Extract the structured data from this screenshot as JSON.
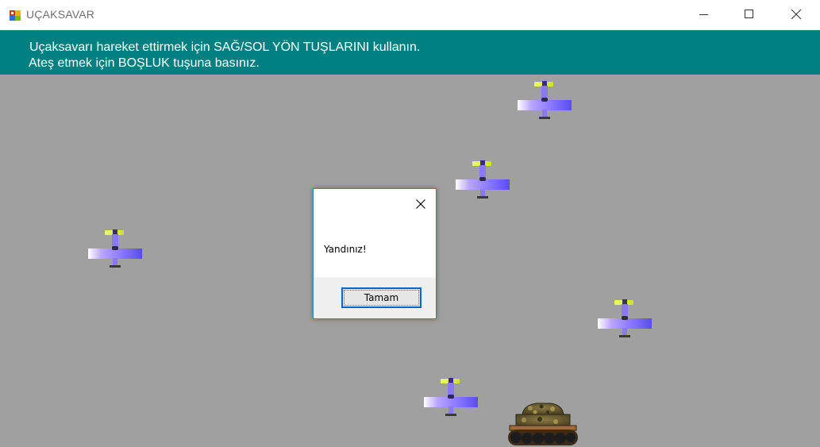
{
  "window": {
    "title": "UÇAKSAVAR",
    "icon": "winforms-app-icon",
    "controls": [
      "minimize-icon",
      "maximize-icon",
      "close-icon"
    ]
  },
  "banner": {
    "line1": "Uçaksavarı hareket ettirmek için SAĞ/SOL YÖN TUŞLARINI kullanın.",
    "line2": "Ateş etmek için BOŞLUK tuşuna basınız.",
    "background": "#008080",
    "text_color": "#ffffff"
  },
  "game": {
    "background": "#a0a0a0",
    "planes": 5,
    "player": "tank"
  },
  "dialog": {
    "message": "Yandınız!",
    "ok_label": "Tamam",
    "accent": "#0a66c4"
  }
}
